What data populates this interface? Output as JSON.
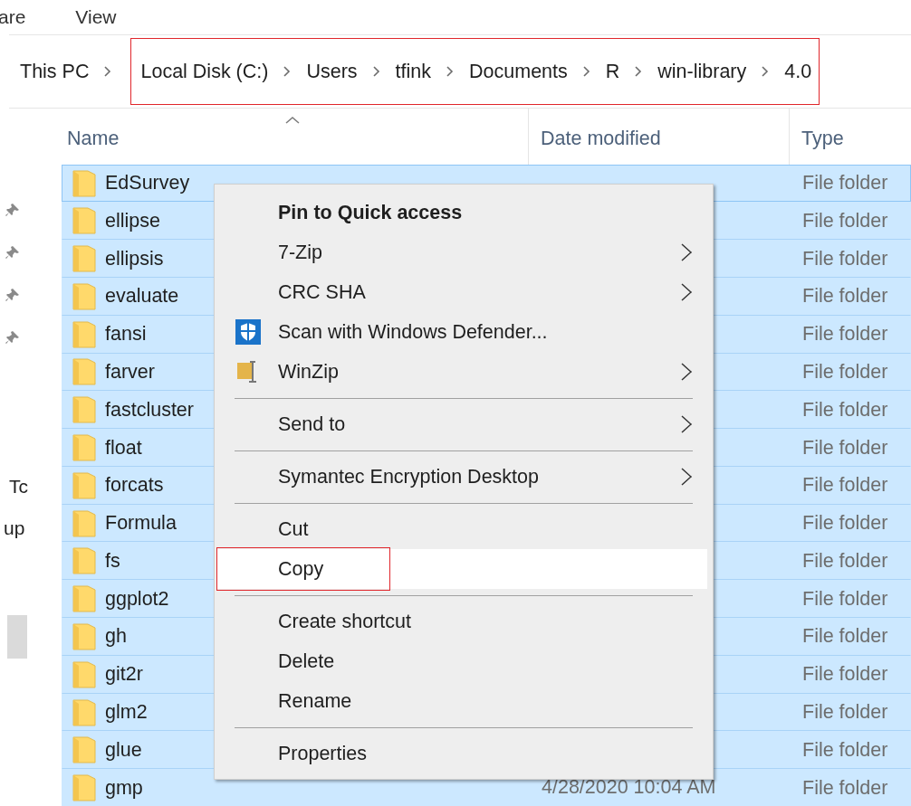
{
  "ribbon_tabs": [
    {
      "label": "are"
    },
    {
      "label": "View"
    }
  ],
  "breadcrumb": [
    "This PC"
  ],
  "highlighted_breadcrumb": [
    "Local Disk (C:)",
    "Users",
    "tfink",
    "Documents",
    "R",
    "win-library",
    "4.0"
  ],
  "nav_pane": {
    "labels": [
      "Tc",
      "up"
    ]
  },
  "columns": [
    "Name",
    "Date modified",
    "Type"
  ],
  "rows": [
    {
      "name": "EdSurvey",
      "type": "File folder",
      "focused": true
    },
    {
      "name": "ellipse",
      "type": "File folder",
      "focused": false
    },
    {
      "name": "ellipsis",
      "type": "File folder",
      "focused": false
    },
    {
      "name": "evaluate",
      "type": "File folder",
      "focused": false
    },
    {
      "name": "fansi",
      "type": "File folder",
      "focused": false
    },
    {
      "name": "farver",
      "type": "File folder",
      "focused": false
    },
    {
      "name": "fastcluster",
      "type": "File folder",
      "focused": false
    },
    {
      "name": "float",
      "type": "File folder",
      "focused": false
    },
    {
      "name": "forcats",
      "type": "File folder",
      "focused": false
    },
    {
      "name": "Formula",
      "type": "File folder",
      "focused": false
    },
    {
      "name": "fs",
      "type": "File folder",
      "focused": false
    },
    {
      "name": "ggplot2",
      "type": "File folder",
      "focused": false
    },
    {
      "name": "gh",
      "type": "File folder",
      "focused": false
    },
    {
      "name": "git2r",
      "type": "File folder",
      "focused": false
    },
    {
      "name": "glm2",
      "type": "File folder",
      "focused": false
    },
    {
      "name": "glue",
      "type": "File folder",
      "focused": false
    },
    {
      "name": "gmp",
      "date": "4/28/2020 10:04 AM",
      "type": "File folder",
      "focused": false
    }
  ],
  "context_menu": [
    {
      "kind": "plain",
      "label": "Pin to Quick access",
      "bold": true,
      "submenu": false,
      "selected": false,
      "highlighted": false
    },
    {
      "kind": "plain",
      "label": "7-Zip",
      "bold": false,
      "submenu": true,
      "selected": false,
      "highlighted": false
    },
    {
      "kind": "plain",
      "label": "CRC SHA",
      "bold": false,
      "submenu": true,
      "selected": false,
      "highlighted": false
    },
    {
      "kind": "shield",
      "label": "Scan with Windows Defender...",
      "bold": false,
      "submenu": false,
      "selected": false,
      "highlighted": false
    },
    {
      "kind": "archive",
      "label": "WinZip",
      "bold": false,
      "submenu": true,
      "selected": false,
      "highlighted": false
    },
    {
      "kind": "separator"
    },
    {
      "kind": "plain",
      "label": "Send to",
      "bold": false,
      "submenu": true,
      "selected": false,
      "highlighted": false
    },
    {
      "kind": "separator"
    },
    {
      "kind": "plain",
      "label": "Symantec Encryption Desktop",
      "bold": false,
      "submenu": true,
      "selected": false,
      "highlighted": false
    },
    {
      "kind": "separator"
    },
    {
      "kind": "plain",
      "label": "Cut",
      "bold": false,
      "submenu": false,
      "selected": false,
      "highlighted": false
    },
    {
      "kind": "plain",
      "label": "Copy",
      "bold": false,
      "submenu": false,
      "selected": true,
      "highlighted": true
    },
    {
      "kind": "separator"
    },
    {
      "kind": "plain",
      "label": "Create shortcut",
      "bold": false,
      "submenu": false,
      "selected": false,
      "highlighted": false
    },
    {
      "kind": "plain",
      "label": "Delete",
      "bold": false,
      "submenu": false,
      "selected": false,
      "highlighted": false
    },
    {
      "kind": "plain",
      "label": "Rename",
      "bold": false,
      "submenu": false,
      "selected": false,
      "highlighted": false
    },
    {
      "kind": "separator"
    },
    {
      "kind": "plain",
      "label": "Properties",
      "bold": false,
      "submenu": false,
      "selected": false,
      "highlighted": false
    }
  ]
}
